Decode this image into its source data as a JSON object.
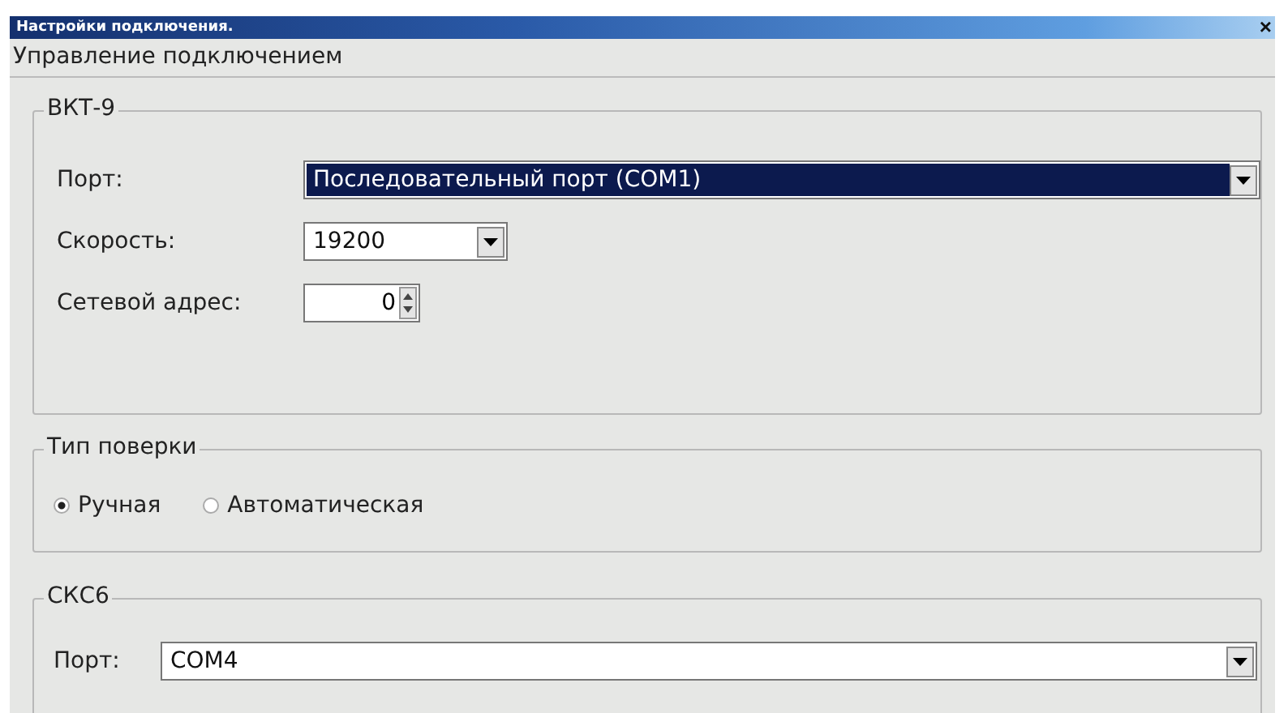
{
  "window": {
    "title": "Настройки подключения.",
    "close": "×"
  },
  "heading": "Управление подключением",
  "device": {
    "title": "ВКТ-9",
    "port": {
      "label": "Порт:",
      "value": "Последовательный порт (COM1)",
      "focused": true
    },
    "speed": {
      "label": "Скорость:",
      "value": "19200"
    },
    "address": {
      "label": "Сетевой адрес:",
      "value": "0"
    }
  },
  "verification": {
    "title": "Тип поверки",
    "options": [
      {
        "label": "Ручная",
        "selected": true
      },
      {
        "label": "Автоматическая",
        "selected": false
      }
    ]
  },
  "skc": {
    "title": "СКС6",
    "port": {
      "label": "Порт:",
      "value": "COM4"
    }
  }
}
